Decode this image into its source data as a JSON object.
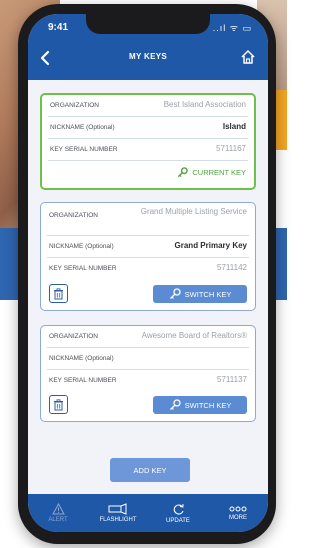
{
  "status": {
    "time": "9:41",
    "icons": "..ıl ᯤ ▭"
  },
  "header": {
    "title": "MY KEYS"
  },
  "cards": [
    {
      "organization_label": "ORGANIZATION",
      "organization": "Best Island Association",
      "nickname_label": "NICKNAME (Optional)",
      "nickname": "Island",
      "serial_label": "KEY SERIAL NUMBER",
      "serial": "5711167",
      "status": "CURRENT KEY"
    },
    {
      "organization_label": "ORGANIZATION",
      "organization": "Grand Multiple Listing Service",
      "nickname_label": "NICKNAME (Optional)",
      "nickname": "Grand Primary Key",
      "serial_label": "KEY SERIAL NUMBER",
      "serial": "5711142",
      "action": "SWITCH KEY"
    },
    {
      "organization_label": "ORGANIZATION",
      "organization": "Awesome Board of Realtors®",
      "nickname_label": "NICKNAME (Optional)",
      "nickname": "",
      "serial_label": "KEY SERIAL NUMBER",
      "serial": "5711137",
      "action": "SWITCH KEY"
    }
  ],
  "add_key_label": "ADD KEY",
  "tabs": [
    {
      "label": "ALERT",
      "icon": "alert-icon"
    },
    {
      "label": "FLASHLIGHT",
      "icon": "flashlight-icon"
    },
    {
      "label": "UPDATE",
      "icon": "update-icon"
    },
    {
      "label": "MORE",
      "icon": "more-icon"
    }
  ],
  "colors": {
    "primary": "#1f58a6",
    "active_border": "#6fbf4b",
    "button": "#5b8bd3"
  }
}
